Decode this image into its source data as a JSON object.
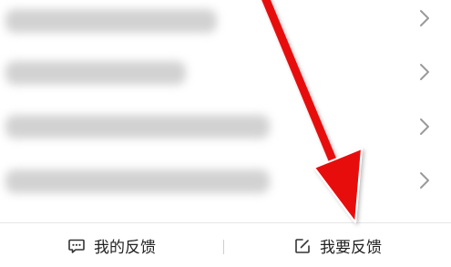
{
  "list": {
    "items": [
      {
        "label": "",
        "blurred": true
      },
      {
        "label": "",
        "blurred": true
      },
      {
        "label": "",
        "blurred": true
      },
      {
        "label": "",
        "blurred": true
      }
    ],
    "chevron_icon": "chevron-right-icon"
  },
  "bottom_bar": {
    "my_feedback": {
      "label": "我的反馈",
      "icon": "chat-bubble-icon"
    },
    "submit_feedback": {
      "label": "我要反馈",
      "icon": "edit-icon"
    }
  },
  "overlay": {
    "arrow_color": "#e8100f",
    "arrow_icon": "arrow-annotation-icon"
  }
}
